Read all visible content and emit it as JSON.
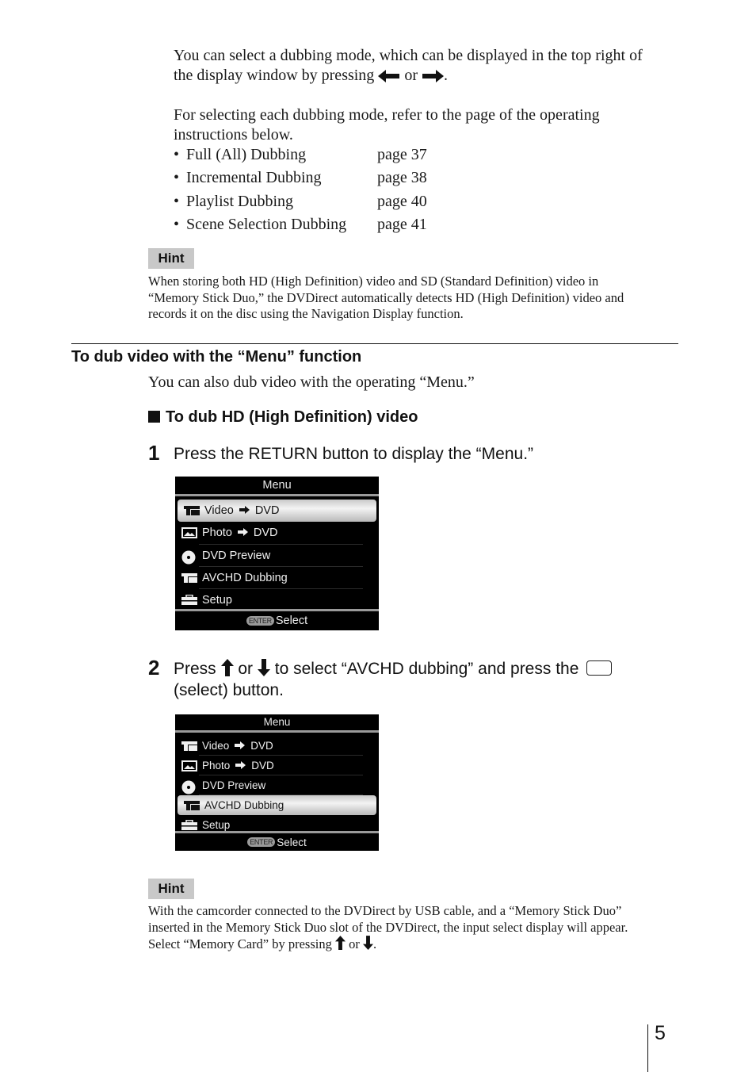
{
  "intro": {
    "line1": "You can select a dubbing mode, which can be displayed in the top right of",
    "line2_before": "the display window by pressing",
    "line2_or": "or",
    "line2_end": ".",
    "left_arrow_icon": "left-arrow-icon",
    "right_arrow_icon": "right-arrow-icon"
  },
  "refer": {
    "line1": "For selecting each dubbing mode, refer to the page of the operating",
    "line2": "instructions below.",
    "items": [
      {
        "label": "Full (All) Dubbing",
        "page": "page 37"
      },
      {
        "label": "Incremental Dubbing",
        "page": "page 38"
      },
      {
        "label": "Playlist Dubbing",
        "page": "page 40"
      },
      {
        "label": "Scene Selection Dubbing",
        "page": "page 41"
      }
    ],
    "bullet": "•"
  },
  "hint1": {
    "badge": "Hint",
    "lines": [
      "When storing both HD (High Definition) video and SD (Standard Definition) video in",
      "“Memory Stick Duo,” the DVDirect automatically detects HD (High Definition) video and",
      "records it on the disc using the Navigation Display function."
    ]
  },
  "section": {
    "title": "To dub video with the “Menu” function",
    "intro": "You can also dub video with the operating “Menu.”",
    "subhead": "To dub HD (High Definition) video"
  },
  "step1": {
    "number": "1",
    "text": "Press the RETURN button to display the “Menu.”"
  },
  "screen1": {
    "title": "Menu",
    "selected_index": 0,
    "items": [
      {
        "icon": "video-icon",
        "parts": [
          "Video",
          "DVD"
        ]
      },
      {
        "icon": "photo-icon",
        "parts": [
          "Photo",
          "DVD"
        ]
      },
      {
        "icon": "disc-icon",
        "parts": [
          "DVD  Preview"
        ]
      },
      {
        "icon": "video-icon",
        "parts": [
          "AVCHD  Dubbing"
        ]
      },
      {
        "icon": "toolbox-icon",
        "parts": [
          "Setup"
        ]
      }
    ],
    "footer_key": "ENTER",
    "footer_label": "Select"
  },
  "step2": {
    "number": "2",
    "text_press": "Press",
    "text_or": "or",
    "text_mid": "to select “AVCHD dubbing” and press the",
    "text_line2": "(select) button.",
    "up_arrow_icon": "up-arrow-icon",
    "down_arrow_icon": "down-arrow-icon",
    "select_button_icon": "select-button-icon"
  },
  "screen2": {
    "title": "Menu",
    "selected_index": 3,
    "items": [
      {
        "icon": "video-icon",
        "parts": [
          "Video",
          "DVD"
        ]
      },
      {
        "icon": "photo-icon",
        "parts": [
          "Photo",
          "DVD"
        ]
      },
      {
        "icon": "disc-icon",
        "parts": [
          "DVD  Preview"
        ]
      },
      {
        "icon": "video-icon",
        "parts": [
          "AVCHD  Dubbing"
        ]
      },
      {
        "icon": "toolbox-icon",
        "parts": [
          "Setup"
        ]
      }
    ],
    "footer_key": "ENTER",
    "footer_label": "Select"
  },
  "hint2": {
    "badge": "Hint",
    "line1": "With the camcorder connected to the DVDirect by USB cable, and a “Memory Stick Duo”",
    "line2": "inserted in the Memory Stick Duo slot of the DVDirect, the input select display will appear.",
    "line3_before": "Select “Memory Card” by pressing",
    "line3_or": "or",
    "line3_end": "."
  },
  "footer": {
    "page_number": "5"
  }
}
